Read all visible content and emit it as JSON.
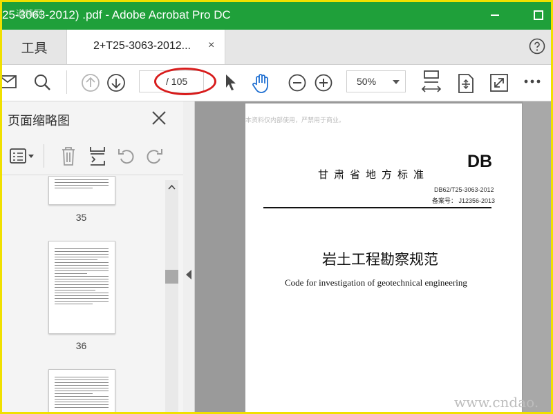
{
  "window": {
    "title": "25-3063-2012)  .pdf - Adobe Acrobat Pro DC",
    "watermark": "道特网"
  },
  "tabs": {
    "tools_label": "工具",
    "doc_label": "2+T25-3063-2012...",
    "close_glyph": "×"
  },
  "toolbar": {
    "page_current": "",
    "page_total": "/ 105",
    "zoom": "50%"
  },
  "sidebar": {
    "title": "页面缩略图",
    "thumbnails": [
      {
        "label": "35"
      },
      {
        "label": "36"
      },
      {
        "label": ""
      }
    ]
  },
  "document": {
    "note": "本资料仅内部使用，严禁用于商业。",
    "standard_org": "甘肃省地方标准",
    "db_mark": "DB",
    "code": "DB62/T25-3063-2012",
    "record": "备案号：  J12356-2013",
    "title_cn": "岩土工程勘察规范",
    "title_en": "Code for investigation of geotechnical engineering"
  },
  "site_watermark": "www.cndao.",
  "colors": {
    "titlebar": "#1fa03a",
    "frame": "#f0e000",
    "annotation": "#d81c1c"
  }
}
